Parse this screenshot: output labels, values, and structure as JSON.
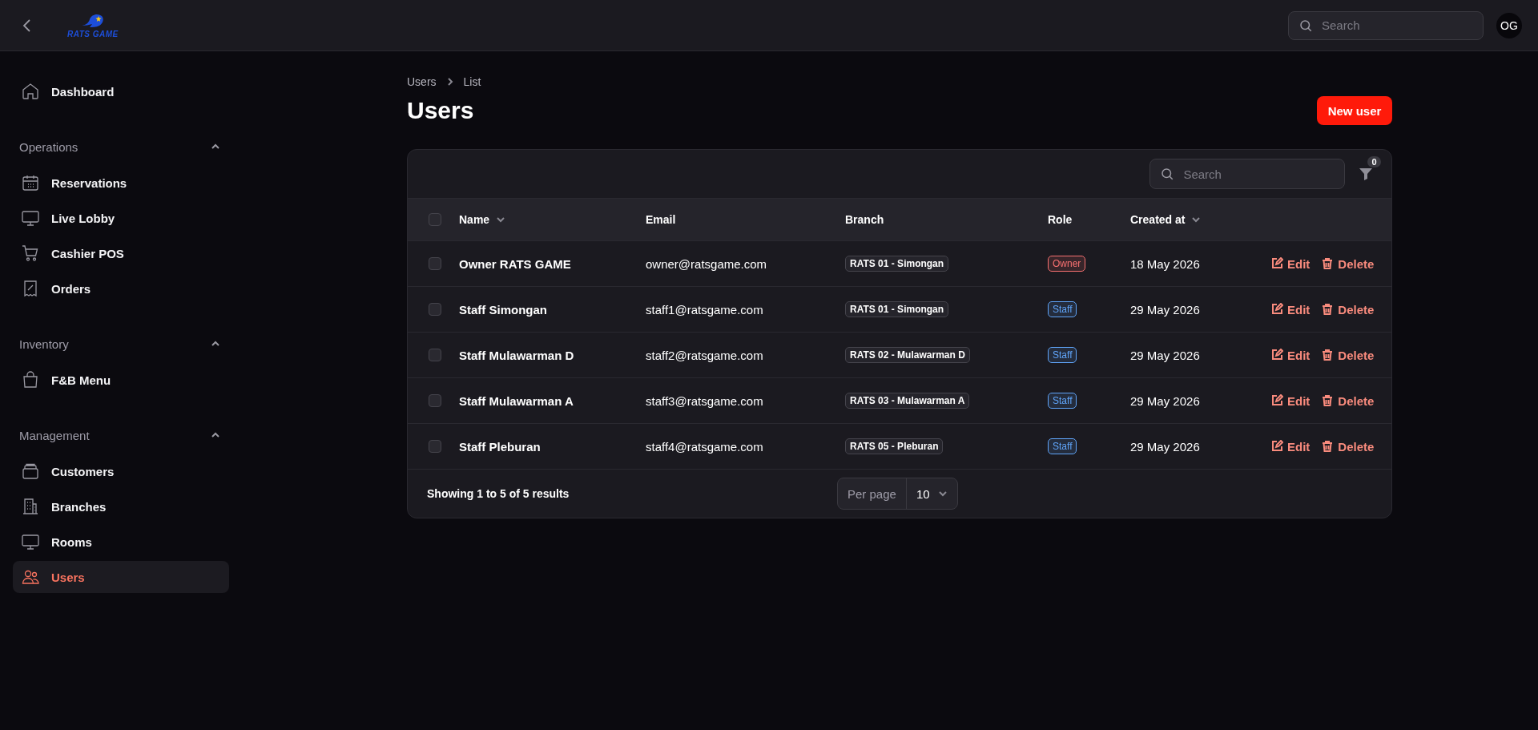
{
  "topbar": {
    "logo_text": "RATS GAME",
    "search": {
      "placeholder": "Search"
    },
    "avatar": "OG"
  },
  "sidebar": {
    "items": [
      {
        "label": "Dashboard",
        "selected": false
      }
    ],
    "groups": [
      {
        "label": "Operations",
        "expanded": true,
        "items": [
          {
            "label": "Reservations",
            "selected": false
          },
          {
            "label": "Live Lobby",
            "selected": false
          },
          {
            "label": "Cashier POS",
            "selected": false
          },
          {
            "label": "Orders",
            "selected": false
          }
        ]
      },
      {
        "label": "Inventory",
        "expanded": true,
        "items": [
          {
            "label": "F&B Menu",
            "selected": false
          }
        ]
      },
      {
        "label": "Management",
        "expanded": true,
        "items": [
          {
            "label": "Customers",
            "selected": false
          },
          {
            "label": "Branches",
            "selected": false
          },
          {
            "label": "Rooms",
            "selected": false
          },
          {
            "label": "Users",
            "selected": true
          }
        ]
      }
    ]
  },
  "breadcrumb": [
    "Users",
    "List"
  ],
  "title": "Users",
  "new_button": "New user",
  "table": {
    "search": {
      "placeholder": "Search"
    },
    "filter_count": "0",
    "all_checked": false,
    "columns": [
      {
        "label": "Name",
        "sortable": true
      },
      {
        "label": "Email",
        "sortable": false
      },
      {
        "label": "Branch",
        "sortable": false
      },
      {
        "label": "Role",
        "sortable": false
      },
      {
        "label": "Created at",
        "sortable": true
      }
    ],
    "rows": [
      {
        "checked": false,
        "name": "Owner RATS GAME",
        "email": "owner@ratsgame.com",
        "branch": "RATS 01 - Simongan",
        "role": {
          "label": "Owner",
          "color": "#f87171"
        },
        "created": "18 May 2026",
        "edit": "Edit",
        "delete": "Delete"
      },
      {
        "checked": false,
        "name": "Staff Simongan",
        "email": "staff1@ratsgame.com",
        "branch": "RATS 01 - Simongan",
        "role": {
          "label": "Staff",
          "color": "#60a5fa"
        },
        "created": "29 May 2026",
        "edit": "Edit",
        "delete": "Delete"
      },
      {
        "checked": false,
        "name": "Staff Mulawarman D",
        "email": "staff2@ratsgame.com",
        "branch": "RATS 02 - Mulawarman D",
        "role": {
          "label": "Staff",
          "color": "#60a5fa"
        },
        "created": "29 May 2026",
        "edit": "Edit",
        "delete": "Delete"
      },
      {
        "checked": false,
        "name": "Staff Mulawarman A",
        "email": "staff3@ratsgame.com",
        "branch": "RATS 03 - Mulawarman A",
        "role": {
          "label": "Staff",
          "color": "#60a5fa"
        },
        "created": "29 May 2026",
        "edit": "Edit",
        "delete": "Delete"
      },
      {
        "checked": false,
        "name": "Staff Pleburan",
        "email": "staff4@ratsgame.com",
        "branch": "RATS 05 - Pleburan",
        "role": {
          "label": "Staff",
          "color": "#60a5fa"
        },
        "created": "29 May 2026",
        "edit": "Edit",
        "delete": "Delete"
      }
    ],
    "summary": "Showing 1 to 5 of 5 results",
    "per_page_label": "Per page",
    "per_page": "10"
  }
}
